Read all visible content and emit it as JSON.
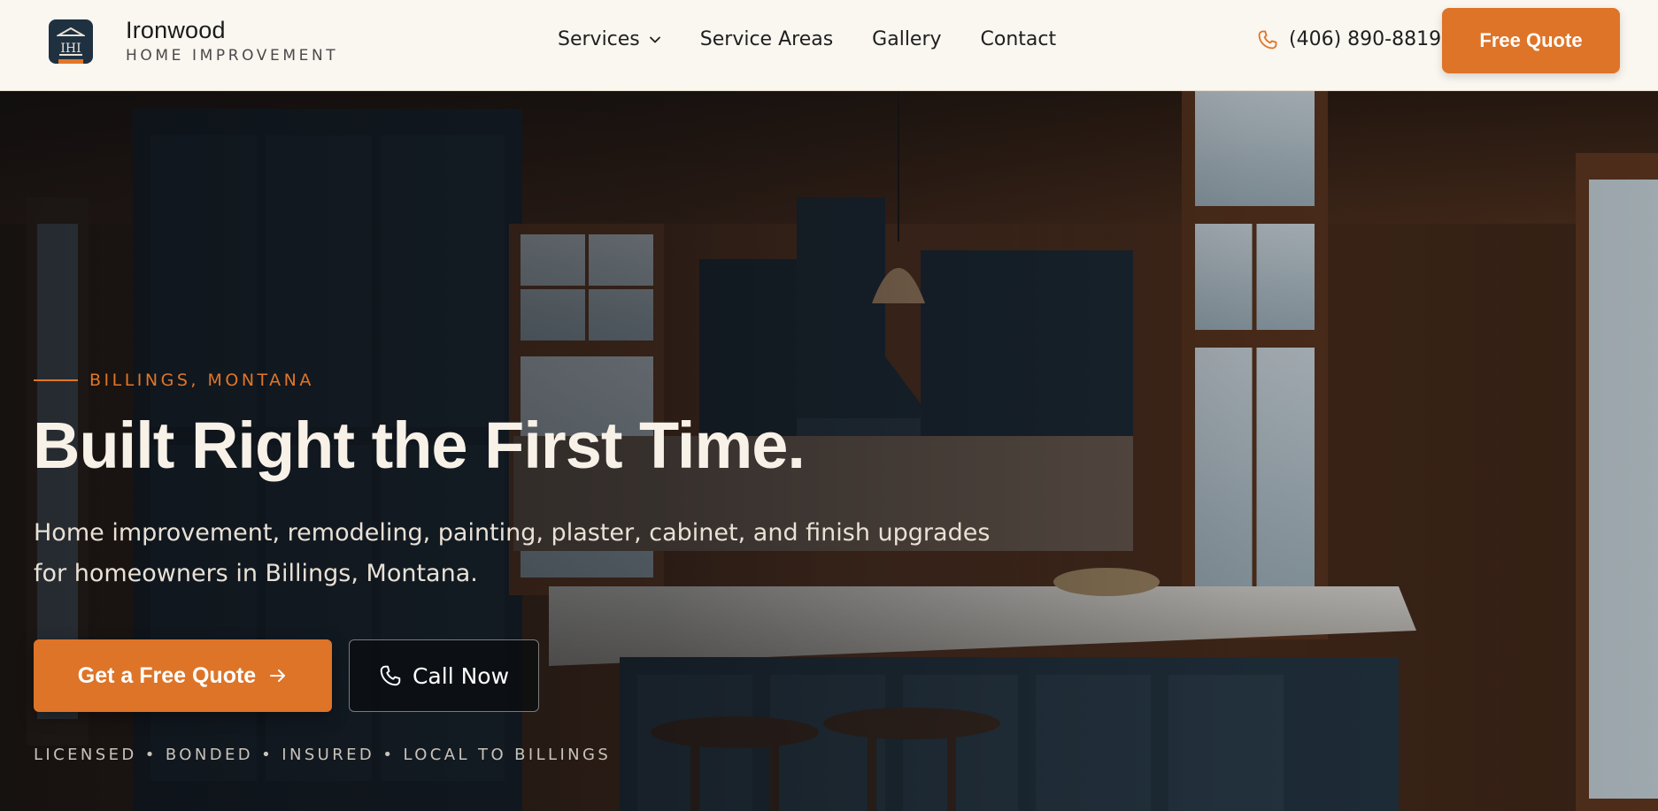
{
  "brand": {
    "name": "Ironwood",
    "subtitle": "HOME IMPROVEMENT",
    "logo_initials": "IHI",
    "accent_color": "#de7428",
    "logo_bg_color": "#1f3140"
  },
  "nav": {
    "items": [
      {
        "label": "Services",
        "icon": "chevron-down-icon"
      },
      {
        "label": "Service Areas"
      },
      {
        "label": "Gallery"
      },
      {
        "label": "Contact"
      }
    ]
  },
  "header": {
    "phone": "(406) 890-8819",
    "phone_icon": "phone-icon",
    "quote_button": "Free Quote",
    "bg_color": "#faf6f0"
  },
  "hero": {
    "eyebrow": "BILLINGS, MONTANA",
    "headline": "Built Right the First Time.",
    "subhead": "Home improvement, remodeling, painting, plaster, cabinet, and finish upgrades for homeowners in Billings, Montana.",
    "primary_cta": "Get a Free Quote",
    "primary_cta_icon": "arrow-right-icon",
    "secondary_cta": "Call Now",
    "secondary_cta_icon": "phone-icon",
    "trust_line": "LICENSED • BONDED • INSURED • LOCAL TO BILLINGS",
    "background": "kitchen-interior-photo"
  }
}
